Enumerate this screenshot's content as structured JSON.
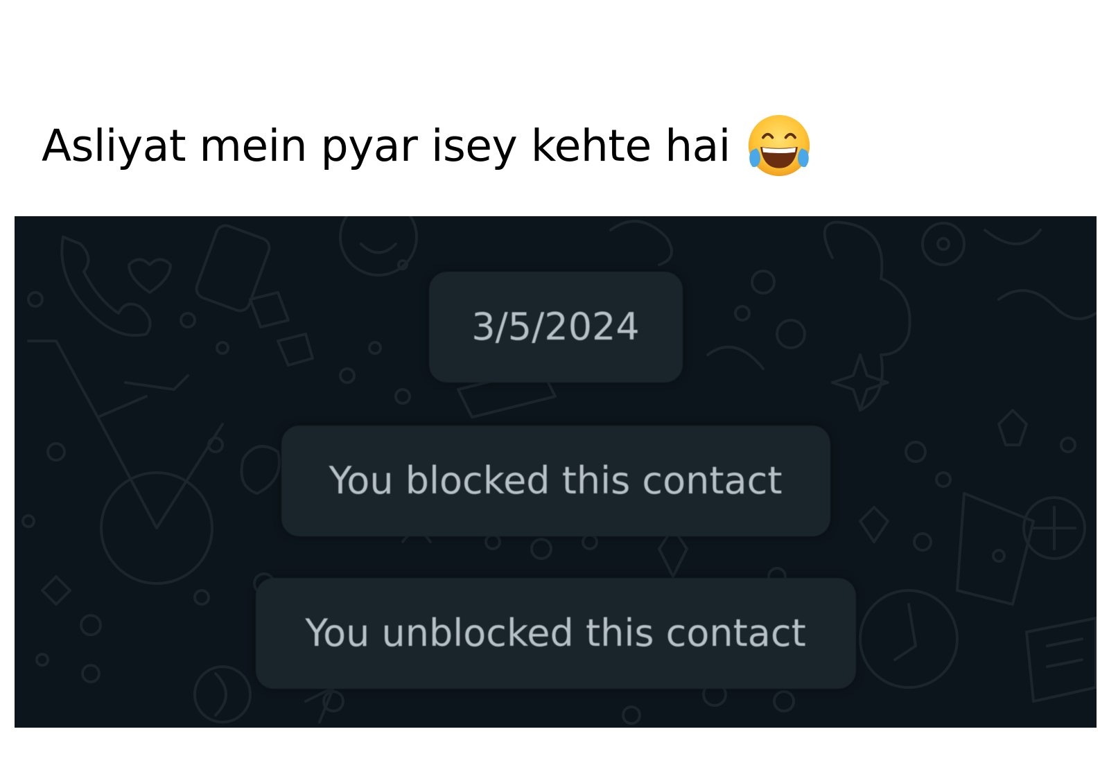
{
  "caption": {
    "text": "Asliyat mein pyar isey kehte hai",
    "emoji_icon": "face-with-tears-of-joy-icon"
  },
  "chat": {
    "background_color": "#0c151b",
    "bubble_color": "#19242b",
    "text_color": "#b6c0c6",
    "wallpaper": "whatsapp-doodle-pattern",
    "messages": [
      {
        "type": "date-divider",
        "text": "3/5/2024"
      },
      {
        "type": "system",
        "text": "You blocked this contact"
      },
      {
        "type": "system",
        "text": "You unblocked this contact"
      }
    ]
  }
}
